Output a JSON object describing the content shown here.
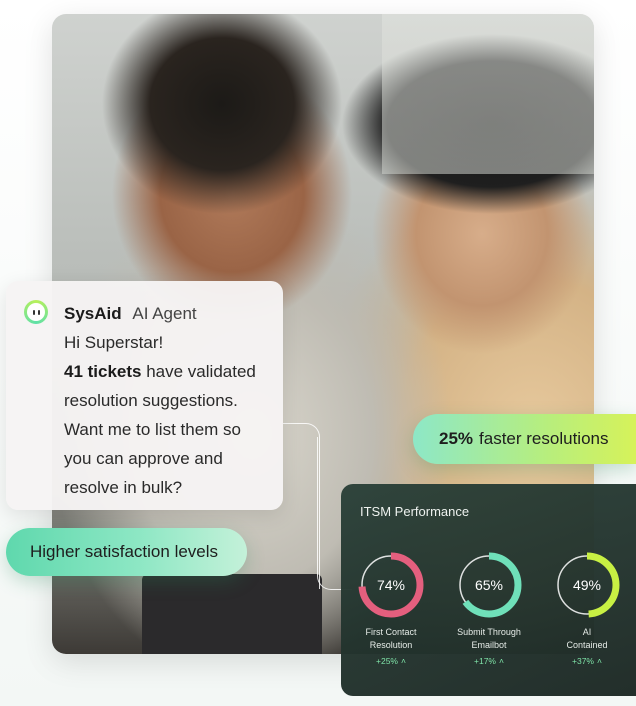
{
  "chat": {
    "brand": "SysAid",
    "agent": "AI Agent",
    "greeting": "Hi Superstar!",
    "tickets_bold": "41 tickets",
    "line1_rest": " have validated",
    "line2": "resolution suggestions.",
    "line3": "Want me to list them so",
    "line4": "you can approve and",
    "line5": "resolve in bulk?"
  },
  "pills": {
    "faster_bold": "25%",
    "faster_rest": "faster resolutions",
    "satisfaction": "Higher satisfaction levels"
  },
  "panel": {
    "title": "ITSM Performance",
    "metrics": [
      {
        "value": "74%",
        "percent": 74,
        "label1": "First Contact",
        "label2": "Resolution",
        "delta": "+25%",
        "color": "#e45f7e"
      },
      {
        "value": "65%",
        "percent": 65,
        "label1": "Submit Through",
        "label2": "Emailbot",
        "delta": "+17%",
        "color": "#6fe0b9"
      },
      {
        "value": "49%",
        "percent": 49,
        "label1": "AI",
        "label2": "Contained",
        "delta": "+37%",
        "color": "#c8f043"
      }
    ]
  }
}
